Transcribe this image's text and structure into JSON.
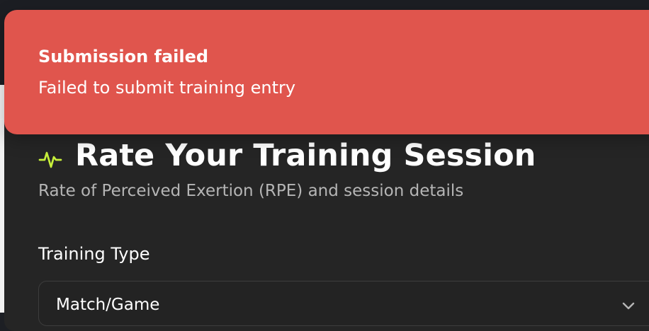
{
  "toast": {
    "title": "Submission failed",
    "description": "Failed to submit training entry",
    "variant": "error",
    "color": "#e0554d"
  },
  "form": {
    "title": "Rate Your Training Session",
    "subtitle": "Rate of Perceived Exertion (RPE) and session details",
    "title_icon": "activity-icon",
    "training_type": {
      "label": "Training Type",
      "value": "Match/Game",
      "icon": "chevron-down-icon"
    }
  },
  "colors": {
    "accent": "#c7ef3b",
    "card_background": "#252525",
    "app_background": "#1c1e23"
  }
}
